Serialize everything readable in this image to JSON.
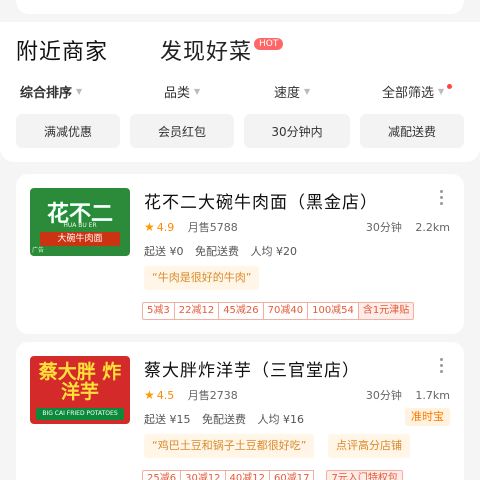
{
  "tabs": [
    {
      "label": "附近商家"
    },
    {
      "label": "发现好菜",
      "badge": "HOT"
    }
  ],
  "sort_bar": [
    {
      "label": "综合排序"
    },
    {
      "label": "品类"
    },
    {
      "label": "速度"
    },
    {
      "label": "全部筛选"
    }
  ],
  "filter_chips": [
    "满减优惠",
    "会员红包",
    "30分钟内",
    "减配送费"
  ],
  "shops": [
    {
      "thumb_title": "花不二",
      "thumb_pinyin": "HUA BU ER",
      "thumb_sub": "大碗牛肉面",
      "thumb_tag": "广告",
      "name": "花不二大碗牛肉面（黑金店）",
      "rating": "4.9",
      "sales": "月售5788",
      "time": "30分钟",
      "distance": "2.2km",
      "min_order": "起送 ¥0",
      "delivery_fee": "免配送费",
      "avg_price": "人均 ¥20",
      "quote": "“牛肉是很好的牛肉”",
      "promos": [
        "5减3",
        "22减12",
        "45减26",
        "70减40",
        "100减54"
      ],
      "promo_extra": "含1元津贴"
    },
    {
      "thumb_title": "蔡大胖 炸洋芋",
      "thumb_sub": "BIG CAI FRIED POTATOES",
      "name": "蔡大胖炸洋芋（三官堂店）",
      "rating": "4.5",
      "sales": "月售2738",
      "time": "30分钟",
      "distance": "1.7km",
      "min_order": "起送 ¥15",
      "delivery_fee": "免配送费",
      "avg_price": "人均 ¥16",
      "ontime": "准时宝",
      "quote": "“鸡巴土豆和锅子土豆都很好吃”",
      "rank": "点评高分店铺",
      "promos": [
        "25减6",
        "30减12",
        "40减12",
        "60减17"
      ],
      "promo_extra": "7元入门特权包"
    }
  ],
  "colors": {
    "accent": "#ff8a00",
    "promo_red": "#e55a3a",
    "hot": "#ff6666"
  }
}
